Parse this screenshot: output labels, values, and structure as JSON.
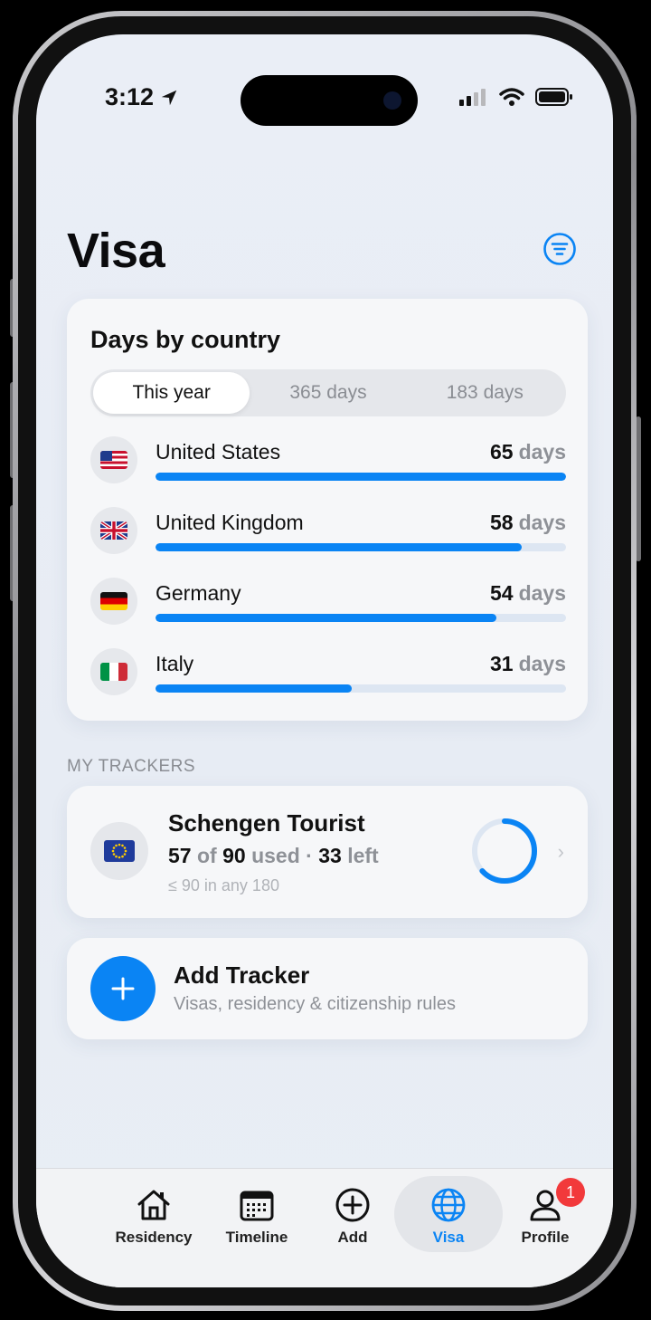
{
  "status": {
    "time": "3:12"
  },
  "header": {
    "title": "Visa"
  },
  "days_card": {
    "title": "Days by country",
    "segments": [
      {
        "label": "This year",
        "active": true
      },
      {
        "label": "365 days",
        "active": false
      },
      {
        "label": "183 days",
        "active": false
      }
    ],
    "countries": [
      {
        "name": "United States",
        "days": "65",
        "unit": "days",
        "fraction": 1.0,
        "flag": "us"
      },
      {
        "name": "United Kingdom",
        "days": "58",
        "unit": "days",
        "fraction": 0.892,
        "flag": "uk"
      },
      {
        "name": "Germany",
        "days": "54",
        "unit": "days",
        "fraction": 0.831,
        "flag": "de"
      },
      {
        "name": "Italy",
        "days": "31",
        "unit": "days",
        "fraction": 0.477,
        "flag": "it"
      }
    ]
  },
  "trackers": {
    "section_label": "MY TRACKERS",
    "items": [
      {
        "name": "Schengen Tourist",
        "used": "57",
        "of_text": "of",
        "limit": "90",
        "used_text": "used",
        "separator": "·",
        "left": "33",
        "left_text": "left",
        "rule": "≤ 90 in any 180",
        "progress": 0.633,
        "flag": "eu"
      }
    ],
    "add": {
      "title": "Add Tracker",
      "subtitle": "Visas, residency & citizenship rules"
    }
  },
  "tabbar": {
    "tabs": [
      {
        "label": "Residency",
        "icon": "house-icon",
        "active": false
      },
      {
        "label": "Timeline",
        "icon": "calendar-icon",
        "active": false
      },
      {
        "label": "Add",
        "icon": "plus-circle-icon",
        "active": false
      },
      {
        "label": "Visa",
        "icon": "globe-icon",
        "active": true
      },
      {
        "label": "Profile",
        "icon": "person-icon",
        "active": false,
        "badge": "1"
      }
    ]
  },
  "colors": {
    "accent": "#0a84f4",
    "track": "#dde6f2",
    "badge": "#f2393b"
  }
}
